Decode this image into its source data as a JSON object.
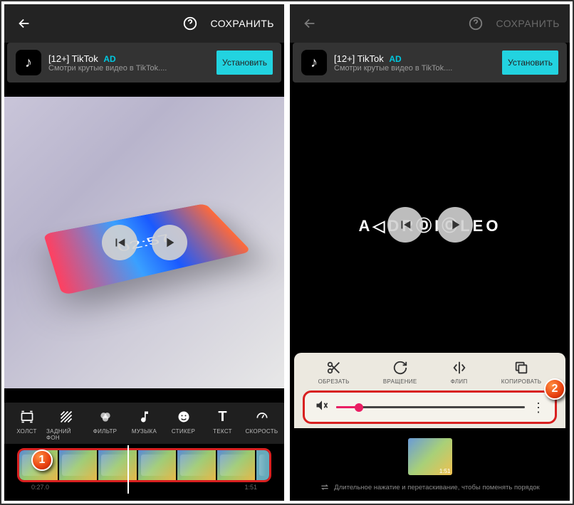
{
  "left": {
    "header": {
      "save": "СОХРАНИТЬ"
    },
    "ad": {
      "title": "[12+] TikTok",
      "badge": "AD",
      "sub": "Смотри крутые видео в TikTok....",
      "cta": "Установить"
    },
    "clock": "02:57",
    "tools": [
      {
        "label": "ХОЛСТ"
      },
      {
        "label": "ЗАДНИЙ ФОН"
      },
      {
        "label": "ФИЛЬТР"
      },
      {
        "label": "МУЗЫКА"
      },
      {
        "label": "СТИКЕР"
      },
      {
        "label": "ТЕКСТ"
      },
      {
        "label": "СКОРОСТЬ"
      }
    ],
    "timecodes": {
      "a": "0:27.0",
      "b": "1:51"
    },
    "marker": "1"
  },
  "right": {
    "header": {
      "save": "СОХРАНИТЬ"
    },
    "ad": {
      "title": "[12+] TikTok",
      "badge": "AD",
      "sub": "Смотри крутые видео в TikTok....",
      "cta": "Установить"
    },
    "logo": "A◁DRⓄIⓄLEO",
    "edit": [
      {
        "label": "ОБРЕЗАТЬ"
      },
      {
        "label": "ВРАЩЕНИЕ"
      },
      {
        "label": "ФЛИП"
      },
      {
        "label": "КОПИРОВАТЬ"
      }
    ],
    "cliptime": "1:51",
    "hint": "Длительное нажатие и перетаскивание, чтобы поменять порядок",
    "marker": "2"
  }
}
